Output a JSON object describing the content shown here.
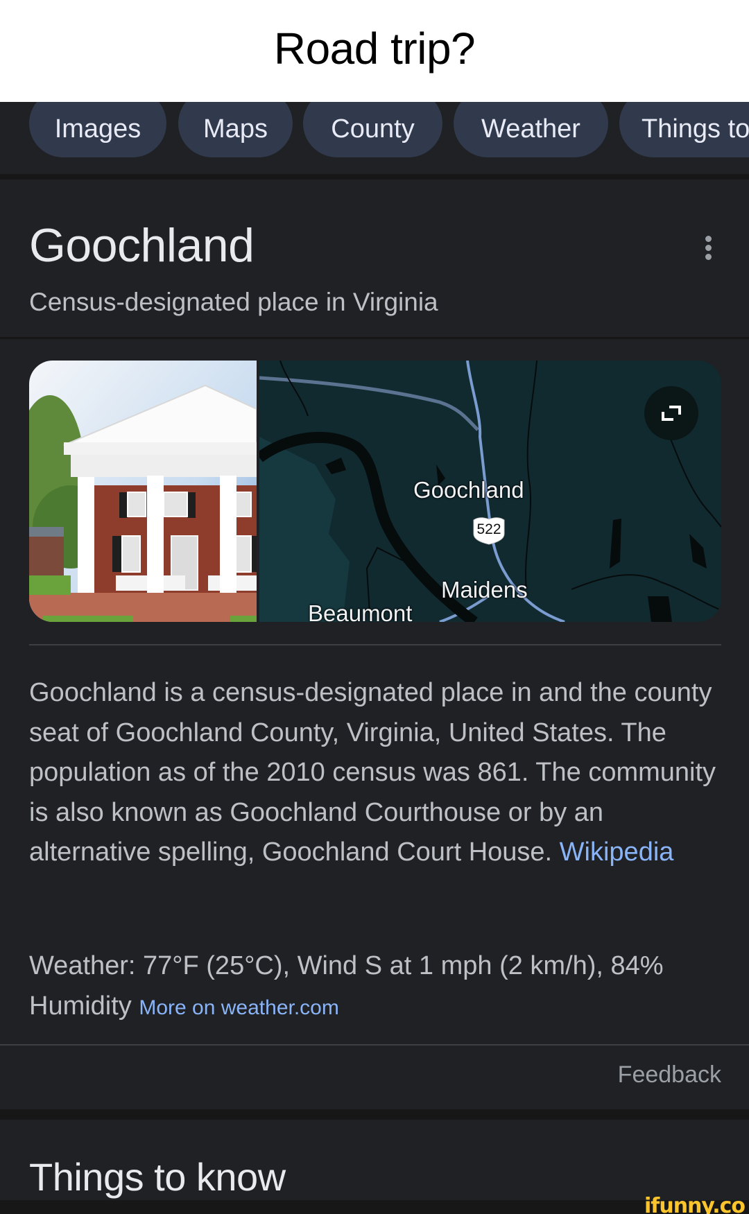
{
  "caption": "Road trip?",
  "chips": [
    {
      "label": "Images"
    },
    {
      "label": "Maps"
    },
    {
      "label": "County"
    },
    {
      "label": "Weather"
    },
    {
      "label": "Things to do"
    }
  ],
  "knowledge_panel": {
    "title": "Goochland",
    "subtitle": "Census-designated place in Virginia",
    "more_icon": "more-vert-icon",
    "photo": {
      "alt": "Goochland County Courthouse (brick building with white columns)"
    },
    "map": {
      "labels": {
        "town": "Goochland",
        "route": "522",
        "south_town": "Maidens",
        "west_town": "Beaumont"
      },
      "expand_icon": "expand-icon"
    },
    "description": "Goochland is a census-designated place in and the county seat of Goochland County, Virginia, United States. The population as of the 2010 census was 861. The community is also known as Goochland Courthouse or by an alternative spelling, Goochland Court House.",
    "source_link": "Wikipedia",
    "weather": {
      "text": "Weather: 77°F (25°C), Wind S at 1 mph (2 km/h), 84% Humidity",
      "link": "More on weather.com"
    },
    "feedback": "Feedback"
  },
  "next_section": {
    "title": "Things to know"
  },
  "watermark": "ifunny.co",
  "colors": {
    "background": "#202124",
    "chip": "#303a4c",
    "link": "#8ab4f8",
    "text_primary": "#e8eaed",
    "text_secondary": "#bdc1c6",
    "watermark": "#fcc42d"
  }
}
